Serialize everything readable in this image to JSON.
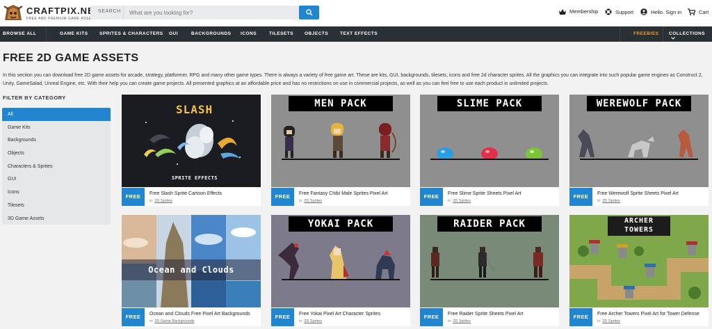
{
  "brand": {
    "name": "CRAFTPIX.NET",
    "tagline": "FREE AND PREMIUM GAME ASSETS"
  },
  "search": {
    "label": "SEARCH",
    "placeholder": "What are you looking for?"
  },
  "header_links": {
    "membership": "Membership",
    "support": "Support",
    "account": "Hello. Sign in",
    "cart": "Cart"
  },
  "nav": {
    "browse": "BROWSE ALL",
    "items": [
      "GAME KITS",
      "SPRITES & CHARACTERS",
      "GUI",
      "BACKGROUNDS",
      "ICONS",
      "TILESETS",
      "OBJECTS",
      "TEXT EFFECTS"
    ],
    "freebies": "FREEBIES",
    "collections": "COLLECTIONS"
  },
  "page": {
    "title": "FREE 2D GAME ASSETS",
    "intro": "In this section you can download free 2D game assets for arcade, strategy, platformer, RPG and many other game types. There is always a variety of free game art. These are kits, GUI, backgrounds, tilesets, icons and free 2d character sprites. All the graphics you can integrate into such popular game engines as Construct 2, Unity, GameSalad, Unreal Engine, etc. With their help you can create game projects. All presented graphics at an affordable price and has no restrictions on use in commercial projects, as well as you can feel free to use each product in unlimited projects."
  },
  "filter": {
    "title": "FILTER BY CATEGORY",
    "items": [
      "All",
      "Game Kits",
      "Backgrounds",
      "Objects",
      "Characters & Sprites",
      "GUI",
      "Icons",
      "Tilesets",
      "3D Game Assets"
    ]
  },
  "badge": "FREE",
  "cat_prefix": "in:",
  "products": [
    {
      "title": "Free Slash Sprite Cartoon Effects",
      "category": "2D Sprites",
      "art_title": "SLASH",
      "art_sub": "SPRITE EFFECTS"
    },
    {
      "title": "Free Fantasy Chibi Male Sprites Pixel Art",
      "category": "2D Sprites",
      "art_title": "MEN PACK"
    },
    {
      "title": "Free Slime Sprite Sheets Pixel Art",
      "category": "2D Sprites",
      "art_title": "SLIME PACK"
    },
    {
      "title": "Free Werewolf Sprite Sheets Pixel Art",
      "category": "2D Sprites",
      "art_title": "WEREWOLF PACK"
    },
    {
      "title": "Ocean and Clouds Free Pixel Art Backgrounds",
      "category": "2D Game Backgrounds",
      "art_title": "Ocean and Clouds"
    },
    {
      "title": "Free Yokai Pixel Art Character Sprites",
      "category": "2D Sprites",
      "art_title": "YOKAI PACK"
    },
    {
      "title": "Free Raider Sprite Sheets Pixel Art",
      "category": "2D Sprites",
      "art_title": "RAIDER PACK"
    },
    {
      "title": "Free Archer Towers Pixel Art for Tower Defense",
      "category": "2D Sprites",
      "art_title": "ARCHER",
      "art_sub": "TOWERS"
    }
  ],
  "colors": {
    "accent": "#2185d0",
    "nav_bg": "#2b3035",
    "freebies": "#f39c3d",
    "page_bg": "#f2f2f2"
  },
  "icons": {
    "search": "search-icon",
    "membership": "crown-icon",
    "support": "lifebuoy-icon",
    "account": "user-icon",
    "cart": "cart-icon",
    "collections": "chevron-down-icon"
  }
}
